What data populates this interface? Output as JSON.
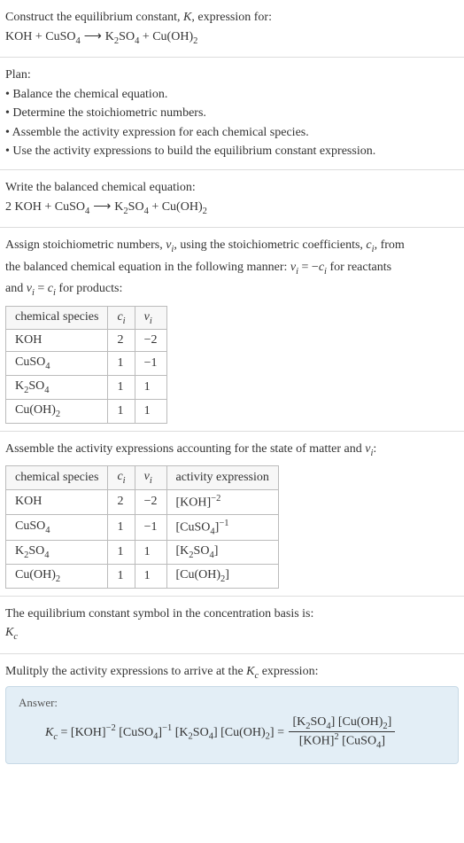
{
  "header": {
    "title_line1": "Construct the equilibrium constant, K, expression for:",
    "equation": "KOH + CuSO₄  ⟶  K₂SO₄ + Cu(OH)₂"
  },
  "plan": {
    "title": "Plan:",
    "items": [
      "• Balance the chemical equation.",
      "• Determine the stoichiometric numbers.",
      "• Assemble the activity expression for each chemical species.",
      "• Use the activity expressions to build the equilibrium constant expression."
    ]
  },
  "balanced": {
    "title": "Write the balanced chemical equation:",
    "equation": "2 KOH + CuSO₄  ⟶  K₂SO₄ + Cu(OH)₂"
  },
  "stoich": {
    "intro1": "Assign stoichiometric numbers, νᵢ, using the stoichiometric coefficients, cᵢ, from",
    "intro2": "the balanced chemical equation in the following manner: νᵢ = −cᵢ for reactants",
    "intro3": "and νᵢ = cᵢ for products:",
    "headers": [
      "chemical species",
      "cᵢ",
      "νᵢ"
    ],
    "rows": [
      {
        "species": "KOH",
        "c": "2",
        "v": "−2"
      },
      {
        "species": "CuSO₄",
        "c": "1",
        "v": "−1"
      },
      {
        "species": "K₂SO₄",
        "c": "1",
        "v": "1"
      },
      {
        "species": "Cu(OH)₂",
        "c": "1",
        "v": "1"
      }
    ]
  },
  "activity": {
    "title": "Assemble the activity expressions accounting for the state of matter and νᵢ:",
    "headers": [
      "chemical species",
      "cᵢ",
      "νᵢ",
      "activity expression"
    ],
    "rows": [
      {
        "species": "KOH",
        "c": "2",
        "v": "−2",
        "expr": "[KOH]⁻²"
      },
      {
        "species": "CuSO₄",
        "c": "1",
        "v": "−1",
        "expr": "[CuSO₄]⁻¹"
      },
      {
        "species": "K₂SO₄",
        "c": "1",
        "v": "1",
        "expr": "[K₂SO₄]"
      },
      {
        "species": "Cu(OH)₂",
        "c": "1",
        "v": "1",
        "expr": "[Cu(OH)₂]"
      }
    ]
  },
  "symbol": {
    "line1": "The equilibrium constant symbol in the concentration basis is:",
    "line2": "K_c"
  },
  "multiply": {
    "title": "Mulitply the activity expressions to arrive at the K_c expression:"
  },
  "answer": {
    "label": "Answer:",
    "lhs": "K_c = [KOH]⁻² [CuSO₄]⁻¹ [K₂SO₄] [Cu(OH)₂] = ",
    "num": "[K₂SO₄] [Cu(OH)₂]",
    "den": "[KOH]² [CuSO₄]"
  },
  "chart_data": {
    "type": "table",
    "tables": [
      {
        "title": "Stoichiometric numbers",
        "columns": [
          "chemical species",
          "c_i",
          "v_i"
        ],
        "rows": [
          [
            "KOH",
            2,
            -2
          ],
          [
            "CuSO4",
            1,
            -1
          ],
          [
            "K2SO4",
            1,
            1
          ],
          [
            "Cu(OH)2",
            1,
            1
          ]
        ]
      },
      {
        "title": "Activity expressions",
        "columns": [
          "chemical species",
          "c_i",
          "v_i",
          "activity expression"
        ],
        "rows": [
          [
            "KOH",
            2,
            -2,
            "[KOH]^-2"
          ],
          [
            "CuSO4",
            1,
            -1,
            "[CuSO4]^-1"
          ],
          [
            "K2SO4",
            1,
            1,
            "[K2SO4]"
          ],
          [
            "Cu(OH)2",
            1,
            1,
            "[Cu(OH)2]"
          ]
        ]
      }
    ]
  }
}
